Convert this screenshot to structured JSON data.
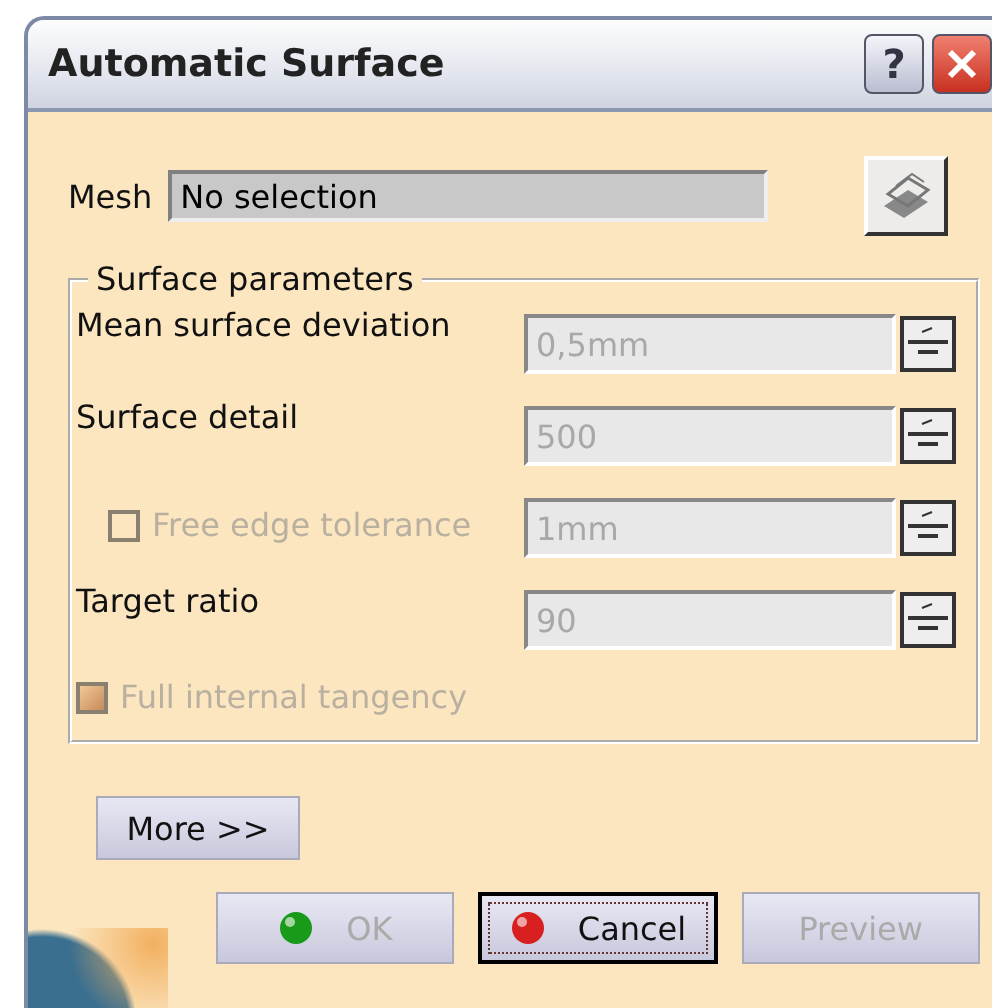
{
  "window": {
    "title": "Automatic Surface",
    "help": "?"
  },
  "mesh": {
    "label": "Mesh",
    "value": "No selection"
  },
  "group": {
    "title": "Surface parameters",
    "rows": [
      {
        "kind": "spin",
        "label": "Mean surface deviation",
        "value": "0,5mm",
        "disabled": true
      },
      {
        "kind": "spin",
        "label": "Surface detail",
        "value": "500",
        "disabled": true
      },
      {
        "kind": "checkspin",
        "label": "Free edge tolerance",
        "value": "1mm",
        "checked": false,
        "disabled": true
      },
      {
        "kind": "spin",
        "label": "Target ratio",
        "value": "90",
        "disabled": true
      }
    ],
    "option": {
      "label": "Full internal tangency",
      "checked": true,
      "disabled": true
    }
  },
  "more": "More >>",
  "buttons": [
    {
      "kind": "ok",
      "label": "OK",
      "disabled": true,
      "focused": false
    },
    {
      "kind": "cancel",
      "label": "Cancel",
      "disabled": false,
      "focused": true
    },
    {
      "kind": "plain",
      "label": "Preview",
      "disabled": true,
      "focused": false
    }
  ]
}
